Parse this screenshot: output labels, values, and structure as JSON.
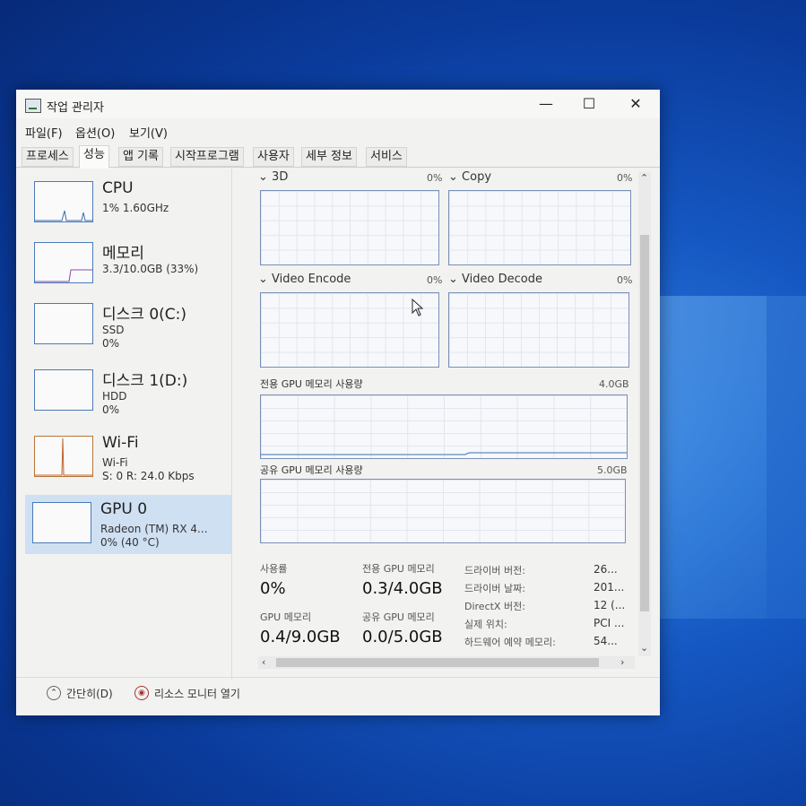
{
  "window": {
    "title": "작업 관리자",
    "minimize": "—",
    "maximize": "☐",
    "close": "✕"
  },
  "menu": [
    "파일(F)",
    "옵션(O)",
    "보기(V)"
  ],
  "tabs": [
    "프로세스",
    "성능",
    "앱 기록",
    "시작프로그램",
    "사용자",
    "세부 정보",
    "서비스"
  ],
  "active_tab": "성능",
  "resources": [
    {
      "name": "CPU",
      "sub1": "1% 1.60GHz",
      "sub2": ""
    },
    {
      "name": "메모리",
      "sub1": "3.3/10.0GB (33%)",
      "sub2": ""
    },
    {
      "name": "디스크 0(C:)",
      "sub1": "SSD",
      "sub2": "0%"
    },
    {
      "name": "디스크 1(D:)",
      "sub1": "HDD",
      "sub2": "0%"
    },
    {
      "name": "Wi-Fi",
      "sub1": "Wi-Fi",
      "sub2": "S: 0 R: 24.0 Kbps"
    },
    {
      "name": "GPU 0",
      "sub1": "Radeon (TM) RX 4...",
      "sub2": "0% (40 °C)"
    }
  ],
  "gpu_graphs": [
    {
      "label": "3D",
      "pct": "0%"
    },
    {
      "label": "Copy",
      "pct": "0%"
    },
    {
      "label": "Video Encode",
      "pct": "0%"
    },
    {
      "label": "Video Decode",
      "pct": "0%"
    }
  ],
  "dedicated_mem": {
    "label": "전용 GPU 메모리 사용량",
    "max": "4.0GB"
  },
  "shared_mem": {
    "label": "공유 GPU 메모리 사용량",
    "max": "5.0GB"
  },
  "stats": {
    "usage_label": "사용률",
    "usage_val": "0%",
    "dedicated_label": "전용 GPU 메모리",
    "dedicated_val": "0.3/4.0GB",
    "gpu_mem_label": "GPU 메모리",
    "gpu_mem_val": "0.4/9.0GB",
    "shared_label": "공유 GPU 메모리",
    "shared_val": "0.0/5.0GB"
  },
  "info": [
    {
      "key": "드라이버 버전:",
      "val": "26..."
    },
    {
      "key": "드라이버 날짜:",
      "val": "201..."
    },
    {
      "key": "DirectX 버전:",
      "val": "12 (..."
    },
    {
      "key": "실제 위치:",
      "val": "PCI ..."
    },
    {
      "key": "하드웨어 예약 메모리:",
      "val": "54..."
    }
  ],
  "footer": {
    "brief": "간단히(D)",
    "resmon": "리소스 모니터 열기"
  },
  "icons": {
    "up": "⌃",
    "down": "⌄",
    "left": "‹",
    "right": "›",
    "chev": "⌄"
  }
}
